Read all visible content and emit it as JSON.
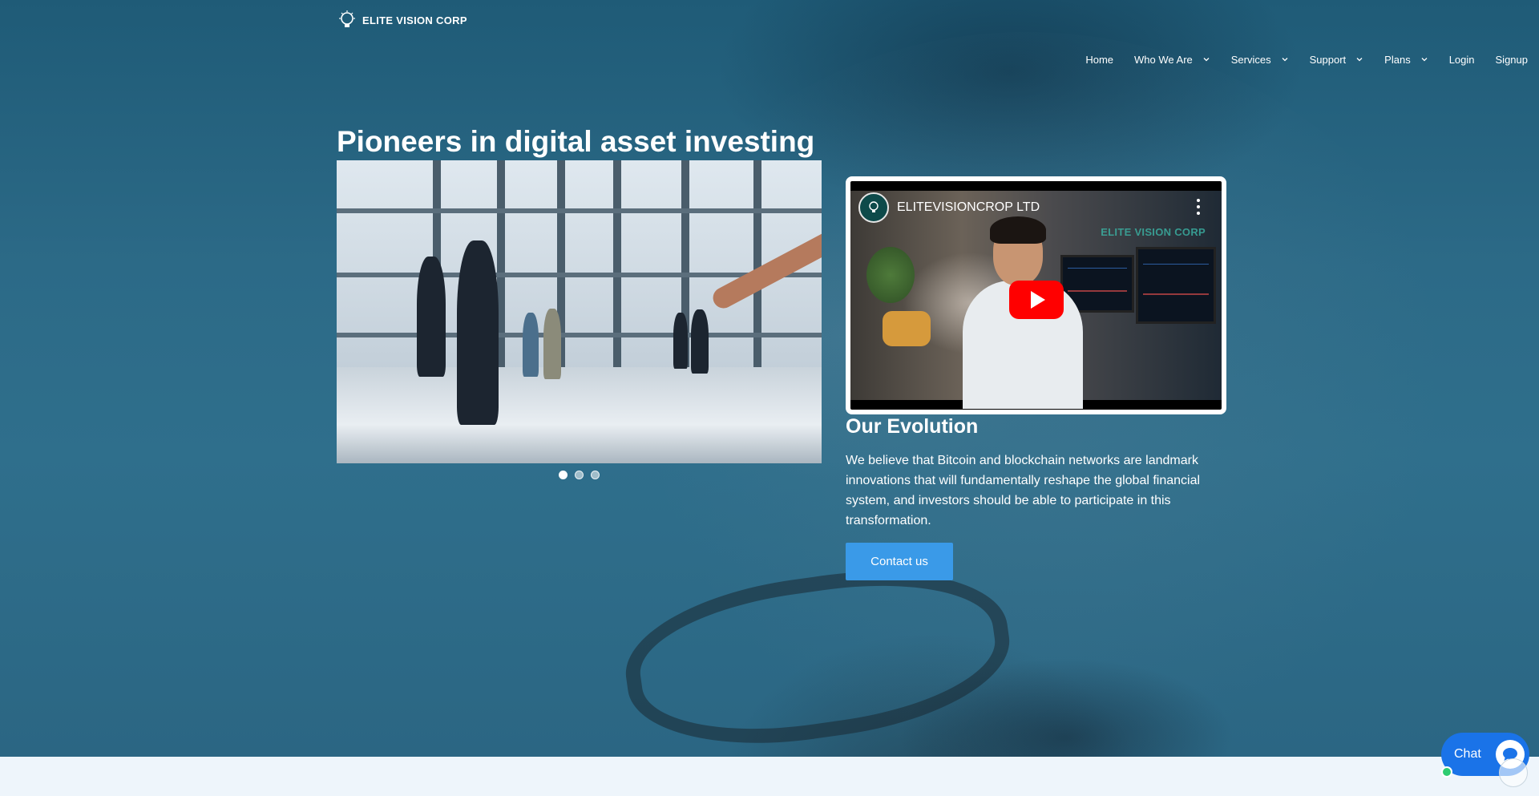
{
  "header": {
    "logo_text": "ELITE VISION CORP",
    "logo_icon": "lightbulb-icon",
    "nav": [
      {
        "label": "Home",
        "dropdown": false
      },
      {
        "label": "Who We Are",
        "dropdown": true
      },
      {
        "label": "Services",
        "dropdown": true
      },
      {
        "label": "Support",
        "dropdown": true
      },
      {
        "label": "Plans",
        "dropdown": true
      },
      {
        "label": "Login",
        "dropdown": false
      },
      {
        "label": "Signup",
        "dropdown": false
      }
    ]
  },
  "hero": {
    "headline": "Pioneers in digital asset investing",
    "slider": {
      "slide_count": 3,
      "active_index": 0
    },
    "video": {
      "channel_name": "ELITEVISIONCROP LTD",
      "watermark": "ELITE VISION CORP",
      "play_icon": "play-icon",
      "menu_icon": "more-vertical-icon"
    },
    "evolution": {
      "title": "Our Evolution",
      "text": "We believe that Bitcoin and blockchain networks are landmark innovations that will fundamentally reshape the global financial system, and investors should be able to participate in this transformation.",
      "button_label": "Contact us"
    }
  },
  "chat_widget": {
    "label": "Chat",
    "icon": "chat-bubble-icon",
    "status_color": "#2ecc71"
  },
  "colors": {
    "hero_overlay": "#2c6a87",
    "button": "#3a9ae8",
    "chat": "#1a73e8",
    "page_bg": "#eef5fb"
  }
}
